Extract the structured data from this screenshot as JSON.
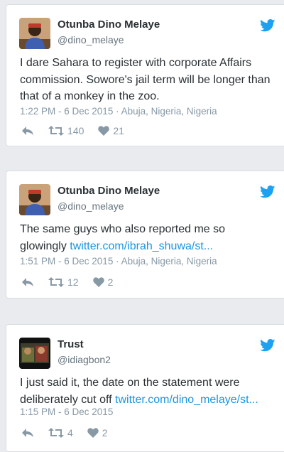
{
  "tweets": [
    {
      "name": "Otunba Dino Melaye",
      "handle": "@dino_melaye",
      "text": "I dare Sahara to register with corporate Affairs commission. Sowore's jail term will be longer than that of a monkey in the zoo.",
      "link": "",
      "meta": "1:22 PM - 6 Dec 2015 · Abuja, Nigeria, Nigeria",
      "retweets": "140",
      "likes": "21",
      "avatar_icon": "profile-photo"
    },
    {
      "name": "Otunba Dino Melaye",
      "handle": "@dino_melaye",
      "text": "The same guys who also reported me so glowingly ",
      "link": "twitter.com/ibrah_shuwa/st...",
      "meta": "1:51 PM - 6 Dec 2015 · Abuja, Nigeria, Nigeria",
      "retweets": "12",
      "likes": "2",
      "avatar_icon": "profile-photo"
    },
    {
      "name": "Trust",
      "handle": "@idiagbon2",
      "text": "I just said it, the date on the statement were deliberately cut off ",
      "link": "twitter.com/dino_melaye/st...",
      "meta": "1:15 PM - 6 Dec 2015",
      "retweets": "4",
      "likes": "2",
      "avatar_icon": "profile-photo"
    }
  ],
  "colors": {
    "twitter_blue": "#1da1f2",
    "link_blue": "#1b95e0",
    "meta_gray": "#8899a6"
  }
}
